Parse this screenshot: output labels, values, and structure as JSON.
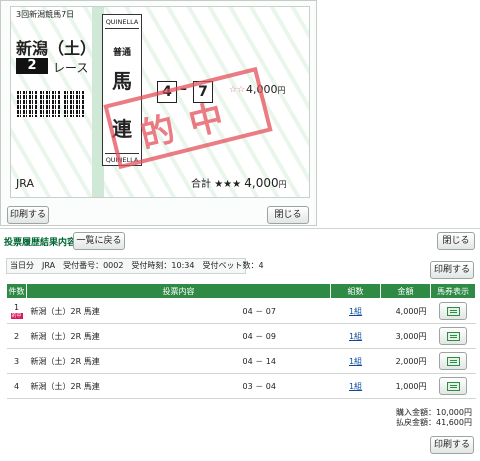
{
  "ticket": {
    "meet_label": "3回新潟競馬7日",
    "venue": "新潟（土）",
    "race_number": "2",
    "race_suffix": "レース",
    "bet_type_en_top": "QUINELLA",
    "bet_type_en_bottom": "QUINELLA",
    "bet_type_small": "普通",
    "bet_type_big_1": "馬",
    "bet_type_big_2": "連",
    "horse_1": "4",
    "horse_2": "7",
    "stars_top": "☆☆",
    "amount_top": "4,000",
    "amount_top_unit": "円",
    "win_stamp": "的中",
    "jra_mark": "JRA",
    "total_label": "合計",
    "total_stars": "★★★",
    "total_amount": "4,000",
    "total_unit": "円"
  },
  "popup": {
    "print_label": "印刷する",
    "close_label": "閉じる"
  },
  "main": {
    "title": "投票履歴結果内容",
    "list_back_label": "一覧に戻る",
    "close_label": "閉じる",
    "info_bar": "当日分　JRA　受付番号：0002　受付時刻：10:34　受付ベット数：4",
    "print_label": "印刷する"
  },
  "table": {
    "headers": [
      "件数",
      "投票内容",
      "組数",
      "金額",
      "馬券表示"
    ],
    "rows": [
      {
        "no": "1",
        "badge": "的中",
        "race": "新潟（土）2R 馬連",
        "combo": "04 － 07",
        "count": "1組",
        "amount": "4,000円"
      },
      {
        "no": "2",
        "badge": "",
        "race": "新潟（土）2R 馬連",
        "combo": "04 － 09",
        "count": "1組",
        "amount": "3,000円"
      },
      {
        "no": "3",
        "badge": "",
        "race": "新潟（土）2R 馬連",
        "combo": "04 － 14",
        "count": "1組",
        "amount": "2,000円"
      },
      {
        "no": "4",
        "badge": "",
        "race": "新潟（土）2R 馬連",
        "combo": "03 － 04",
        "count": "1組",
        "amount": "1,000円"
      }
    ]
  },
  "totals": {
    "purchase": "購入金額：10,000円",
    "refund": "払戻金額：41,600円"
  },
  "colors": {
    "accent": "#2f8a46",
    "win_stamp": "#e4505a",
    "hit_badge": "#d81b5a"
  }
}
